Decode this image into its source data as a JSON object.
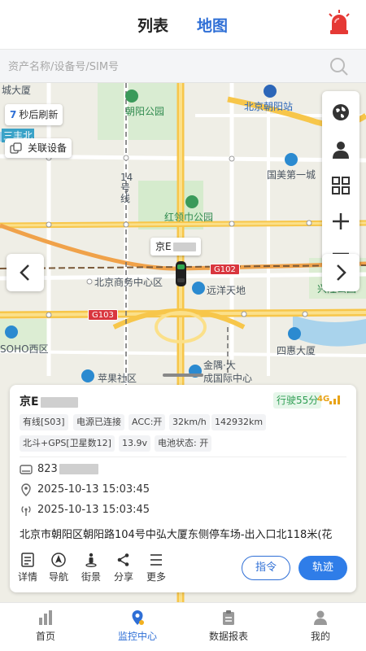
{
  "header": {
    "tab_list": "列表",
    "tab_map": "地图"
  },
  "search": {
    "placeholder": "资产名称/设备号/SIM号"
  },
  "map": {
    "refresh_count": "7",
    "refresh_label": "秒后刷新",
    "linked_device": "关联设备",
    "labels": {
      "chaoyang_park": "朝阳公园",
      "beijing_chaoyang_station": "北京朝阳站",
      "guomei": "国美第一城",
      "hongling_park": "红领巾公园",
      "line14": "14号线",
      "cbd": "北京商务中心区",
      "yuanyang": "远洋天地",
      "soho": "SOHO西区",
      "sihui": "四惠大厦",
      "jinyu": "金隅·大",
      "chengguoji": "成国际中心",
      "pingguo": "苹果社区",
      "xingzhuang": "兴隆公园",
      "chengdalou": "城大厦",
      "sanfeng": "三丰北"
    },
    "road_signs": {
      "g102": "G102",
      "g103": "G103"
    },
    "car_label_prefix": "京E"
  },
  "card": {
    "plate_prefix": "京E",
    "status": "行驶55分",
    "network": "4G",
    "tags": [
      "有线[S03]",
      "电源已连接",
      "ACC:开",
      "32km/h",
      "142932km",
      "北斗+GPS[卫星数12]",
      "13.9v",
      "电池状态: 开"
    ],
    "sim_prefix": "823",
    "gps_time": "2025-10-13 15:03:45",
    "signal_time": "2025-10-13 15:03:45",
    "address": "北京市朝阳区朝阳路104号中弘大厦东侧停车场-出入口北118米(花",
    "actions": [
      "详情",
      "导航",
      "街景",
      "分享",
      "更多"
    ],
    "btn_command": "指令",
    "btn_track": "轨迹"
  },
  "nav": {
    "items": [
      "首页",
      "监控中心",
      "数据报表",
      "我的"
    ],
    "active": "监控中心"
  },
  "colors": {
    "accent": "#2f6fd6",
    "status_green": "#2d9d52",
    "alarm_red": "#e53935"
  }
}
